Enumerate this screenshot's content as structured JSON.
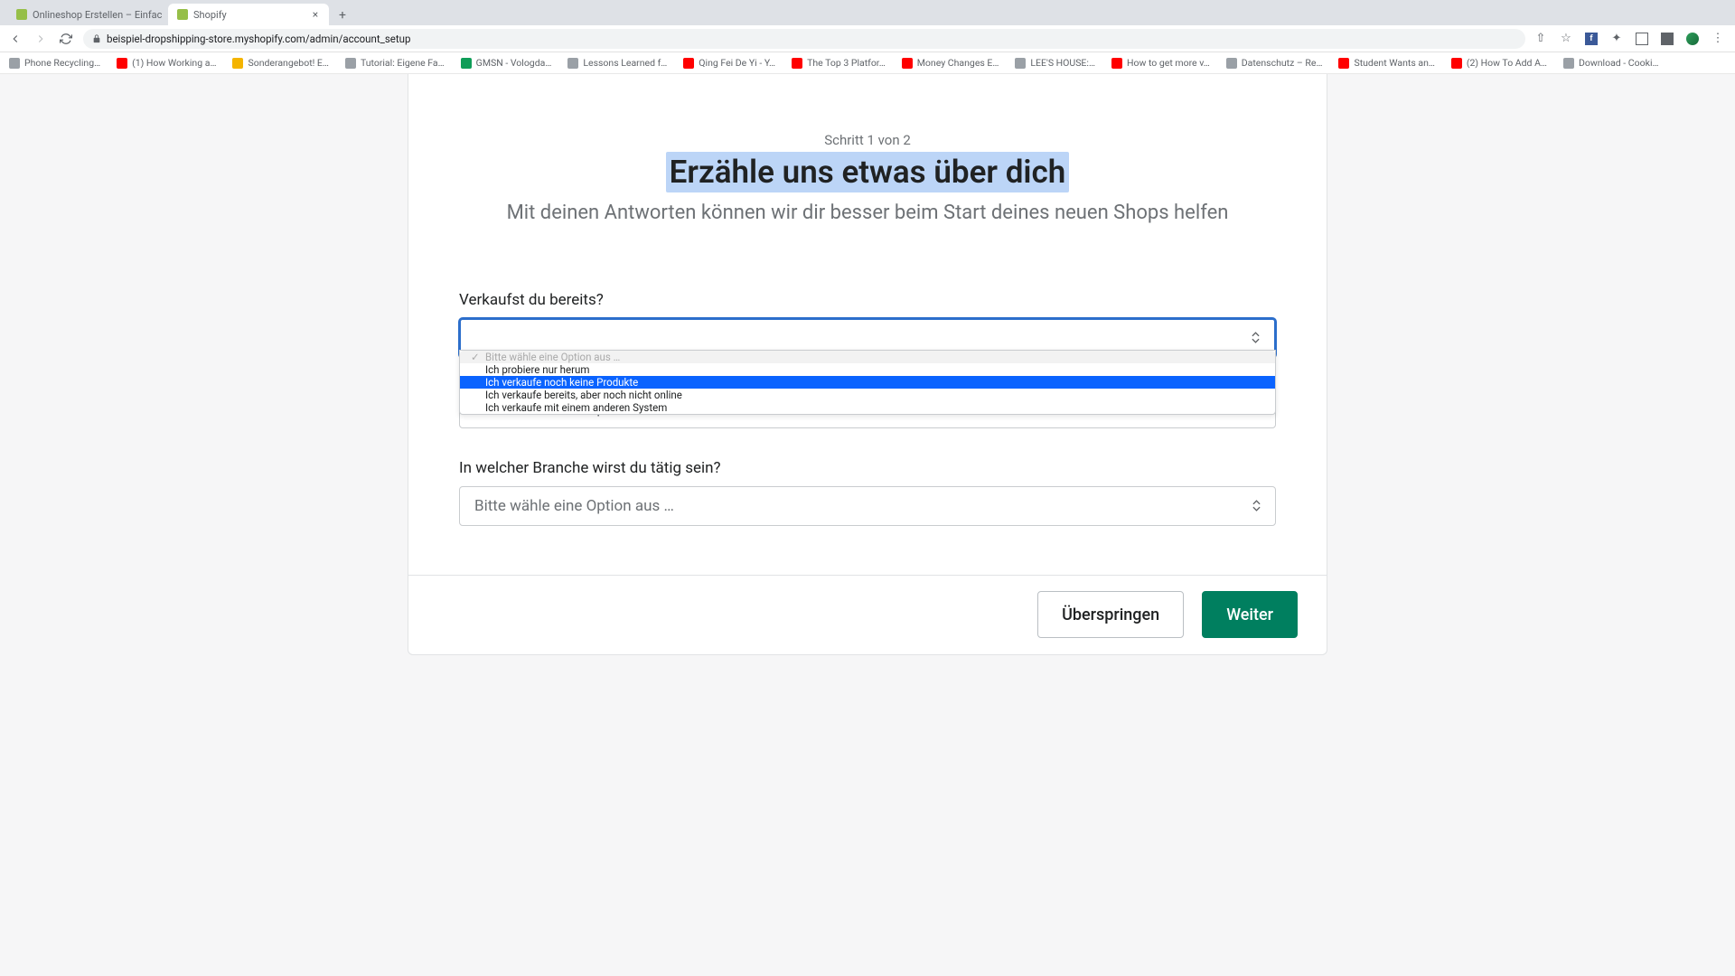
{
  "tabs": {
    "inactive": "Onlineshop Erstellen – Einfac",
    "active": "Shopify"
  },
  "url": "beispiel-dropshipping-store.myshopify.com/admin/account_setup",
  "bookmarks": [
    "Phone Recycling…",
    "(1) How Working a…",
    "Sonderangebot! E…",
    "Tutorial: Eigene Fa…",
    "GMSN - Vologda…",
    "Lessons Learned f…",
    "Qing Fei De Yi - Y…",
    "The Top 3 Platfor…",
    "Money Changes E…",
    "LEE'S HOUSE:…",
    "How to get more v…",
    "Datenschutz – Re…",
    "Student Wants an…",
    "(2) How To Add A…",
    "Download - Cooki…"
  ],
  "bm_colors": [
    "gr",
    "red",
    "or",
    "gr",
    "grn",
    "gr",
    "red",
    "red",
    "red",
    "gr",
    "red",
    "gr",
    "red",
    "red",
    "gr"
  ],
  "step": "Schritt 1 von 2",
  "title": "Erzähle uns etwas über dich",
  "subtitle": "Mit deinen Antworten können wir dir besser beim Start deines neuen Shops helfen",
  "q1": {
    "label": "Verkaufst du bereits?",
    "placeholder": "",
    "options": [
      "Bitte wähle eine Option aus …",
      "Ich probiere nur herum",
      "Ich verkaufe noch keine Produkte",
      "Ich verkaufe bereits, aber noch nicht online",
      "Ich verkaufe mit einem anderen System"
    ],
    "selected_index": 2
  },
  "q2_placeholder": "Bitte wähle eine Option aus …",
  "q3": {
    "label": "In welcher Branche wirst du tätig sein?",
    "placeholder": "Bitte wähle eine Option aus …"
  },
  "buttons": {
    "skip": "Überspringen",
    "next": "Weiter"
  }
}
